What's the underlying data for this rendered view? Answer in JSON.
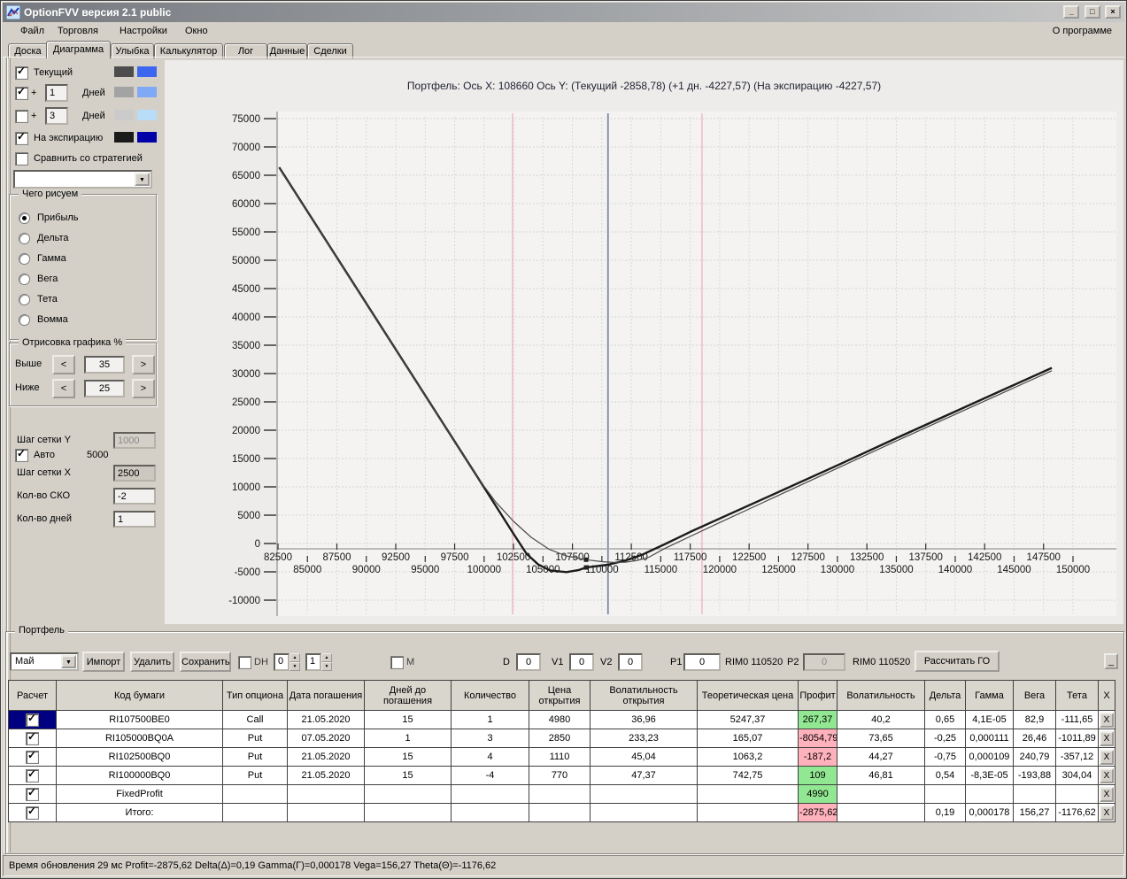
{
  "window": {
    "title": "OptionFVV версия 2.1 public",
    "controls": {
      "minimize": "_",
      "maximize": "□",
      "close": "×"
    }
  },
  "menu": {
    "items": [
      "Файл",
      "Торговля",
      "Настройки",
      "Окно"
    ],
    "right": "О программе"
  },
  "tabs": {
    "items": [
      "Доска",
      "Диаграмма",
      "Улыбка",
      "Калькулятор",
      "Лог",
      "Данные",
      "Сделки"
    ],
    "active": "Диаграмма"
  },
  "left_panel": {
    "legend_rows": [
      {
        "label": "Текущий",
        "checked": true,
        "colors": [
          "#4d4d4d",
          "#3c66f0"
        ]
      },
      {
        "prefix": "+",
        "value": "1",
        "label": "Дней",
        "checked": true,
        "colors": [
          "#a3a3a3",
          "#7fa8f5"
        ]
      },
      {
        "prefix": "+",
        "value": "3",
        "label": "Дней",
        "checked": false,
        "colors": [
          "#cbcbcb",
          "#b9dcf8"
        ]
      },
      {
        "label": "На экспирацию",
        "checked": true,
        "colors": [
          "#1a1a1a",
          "#0000a8"
        ]
      },
      {
        "label": "Сравнить со стратегией",
        "checked": false
      }
    ],
    "strategy_value": "",
    "draw_group": {
      "title": "Чего рисуем",
      "options": [
        "Прибыль",
        "Дельта",
        "Гамма",
        "Вега",
        "Тета",
        "Вомма"
      ],
      "selected": "Прибыль"
    },
    "render_group": {
      "title": "Отрисовка графика %",
      "dec": "<",
      "inc": ">",
      "rows": [
        {
          "label": "Выше",
          "value": "35"
        },
        {
          "label": "Ниже",
          "value": "25"
        }
      ]
    },
    "grid": {
      "y_label": "Шаг сетки Y",
      "y_value": "1000",
      "auto_label": "Авто",
      "auto_checked": true,
      "auto_value": "5000",
      "x_label": "Шаг сетки X",
      "x_value": "2500",
      "sko_label": "Кол-во СКО",
      "sko_value": "-2",
      "days_label": "Кол-во дней",
      "days_value": "1"
    }
  },
  "chart": {
    "title": "Портфель: Ось X: 108660 Ось Y:  (Текущий -2858,78)  (+1 дн. -4227,57)  (На экспирацию -4227,57)"
  },
  "chart_data": {
    "type": "line",
    "title": "Портфель: Ось X: 108660 Ось Y:  (Текущий -2858,78)  (+1 дн. -4227,57)  (На экспирацию -4227,57)",
    "x_range": [
      82500,
      151000
    ],
    "y_range": [
      -10000,
      75000
    ],
    "x_grid_step": 2500,
    "y_grid_step": 5000,
    "grid": true,
    "y_ticks": [
      75000,
      70000,
      65000,
      60000,
      55000,
      50000,
      45000,
      40000,
      35000,
      30000,
      25000,
      20000,
      15000,
      10000,
      5000,
      0,
      -5000,
      -10000
    ],
    "x_ticks_row1": [
      82500,
      87500,
      92500,
      97500,
      102500,
      107500,
      112500,
      117500,
      122500,
      127500,
      132500,
      137500,
      142500,
      147500
    ],
    "x_ticks_row2": [
      85000,
      90000,
      95000,
      100000,
      105000,
      110000,
      115000,
      120000,
      125000,
      130000,
      135000,
      140000,
      145000,
      150000
    ],
    "vlines": [
      {
        "x": 102420,
        "color": "#f2b6c0",
        "name": "sigma-lower"
      },
      {
        "x": 110520,
        "color": "#7d8aa0",
        "name": "current-price"
      },
      {
        "x": 118500,
        "color": "#f2b6c0",
        "name": "sigma-upper"
      }
    ],
    "series": [
      {
        "name": "На экспирацию / +1 дн.",
        "color": "#1b1b1b",
        "width": 2.4,
        "points": [
          [
            82600,
            66400
          ],
          [
            100000,
            9900
          ],
          [
            102500,
            1700
          ],
          [
            103600,
            -1800
          ],
          [
            104600,
            -3700
          ],
          [
            105600,
            -4750
          ],
          [
            107000,
            -5050
          ],
          [
            108000,
            -4700
          ],
          [
            108660,
            -4230
          ],
          [
            110500,
            -3750
          ],
          [
            112000,
            -3000
          ],
          [
            113500,
            -1900
          ],
          [
            115300,
            -150
          ],
          [
            117500,
            2050
          ],
          [
            120000,
            4400
          ],
          [
            125000,
            9100
          ],
          [
            130000,
            13800
          ],
          [
            135000,
            18600
          ],
          [
            140000,
            23300
          ],
          [
            145000,
            28000
          ],
          [
            148200,
            31000
          ]
        ]
      },
      {
        "name": "Текущий",
        "color": "#4a4a4a",
        "width": 1.2,
        "points": [
          [
            82600,
            66350
          ],
          [
            99500,
            11500
          ],
          [
            101000,
            7300
          ],
          [
            102500,
            3900
          ],
          [
            104000,
            1100
          ],
          [
            105500,
            -1000
          ],
          [
            107000,
            -2200
          ],
          [
            108660,
            -2860
          ],
          [
            110000,
            -3200
          ],
          [
            111000,
            -3350
          ],
          [
            112000,
            -3300
          ],
          [
            113000,
            -3000
          ],
          [
            114000,
            -2400
          ],
          [
            115300,
            -900
          ],
          [
            117500,
            1250
          ],
          [
            120000,
            3700
          ],
          [
            122500,
            6100
          ],
          [
            125000,
            8500
          ],
          [
            127500,
            10900
          ],
          [
            130000,
            13300
          ],
          [
            135000,
            18100
          ],
          [
            140000,
            22800
          ],
          [
            145000,
            27500
          ],
          [
            148200,
            30500
          ]
        ]
      }
    ],
    "markers": [
      {
        "x": 108660,
        "y": -2858.78,
        "series": "Текущий"
      },
      {
        "x": 108660,
        "y": -4227.57,
        "series": "На экспирацию / +1 дн."
      }
    ],
    "crosshair": {
      "x": 108660,
      "current": "-2858,78",
      "plus1day": "-4227,57",
      "expiration": "-4227,57"
    }
  },
  "portfolio": {
    "group_label": "Портфель",
    "toolbar": {
      "month_value": "Май",
      "import_label": "Импорт",
      "delete_label": "Удалить",
      "save_label": "Сохранить",
      "dh_label": "DH",
      "dh_checked": false,
      "spin1_value": "0",
      "spin2_value": "1",
      "m_label": "M",
      "m_checked": false,
      "d_label": "D",
      "d_value": "0",
      "v1_label": "V1",
      "v1_value": "0",
      "v2_label": "V2",
      "v2_value": "0",
      "p1_label": "P1",
      "p1_value": "0",
      "rim1_label": "RIM0 110520",
      "p2_label": "P2",
      "p2_value": "0",
      "rim2_label": "RIM0 110520",
      "calc_label": "Рассчитать ГО",
      "minimize_label": "_"
    },
    "table": {
      "headers": [
        "Расчет",
        "Код бумаги",
        "Тип опциона",
        "Дата погашения",
        "Дней до погашения",
        "Количество",
        "Цена открытия",
        "Волатильность открытия",
        "Теоретическая цена",
        "Профит",
        "Волатильность",
        "Дельта",
        "Гамма",
        "Вега",
        "Тета",
        "X"
      ],
      "x_button_label": "X",
      "profit_colors": {
        "green": "#92e892",
        "red": "#ffb2bc"
      },
      "rows": [
        {
          "checked": true,
          "selected": true,
          "profit_color": "green",
          "cells": [
            "RI107500BE0",
            "Call",
            "21.05.2020",
            "15",
            "1",
            "4980",
            "36,96",
            "5247,37",
            "267,37",
            "40,2",
            "0,65",
            "4,1E-05",
            "82,9",
            "-111,65"
          ]
        },
        {
          "checked": true,
          "selected": false,
          "profit_color": "red",
          "cells": [
            "RI105000BQ0A",
            "Put",
            "07.05.2020",
            "1",
            "3",
            "2850",
            "233,23",
            "165,07",
            "-8054,79",
            "73,65",
            "-0,25",
            "0,000111",
            "26,46",
            "-1011,89"
          ]
        },
        {
          "checked": true,
          "selected": false,
          "profit_color": "red",
          "cells": [
            "RI102500BQ0",
            "Put",
            "21.05.2020",
            "15",
            "4",
            "1110",
            "45,04",
            "1063,2",
            "-187,2",
            "44,27",
            "-0,75",
            "0,000109",
            "240,79",
            "-357,12"
          ]
        },
        {
          "checked": true,
          "selected": false,
          "profit_color": "green",
          "cells": [
            "RI100000BQ0",
            "Put",
            "21.05.2020",
            "15",
            "-4",
            "770",
            "47,37",
            "742,75",
            "109",
            "46,81",
            "0,54",
            "-8,3E-05",
            "-193,88",
            "304,04"
          ]
        },
        {
          "checked": true,
          "selected": false,
          "profit_color": "green",
          "cells": [
            "FixedProfit",
            "",
            "",
            "",
            "",
            "",
            "",
            "",
            "4990",
            "",
            "",
            "",
            "",
            ""
          ]
        },
        {
          "checked": true,
          "selected": false,
          "profit_color": "red",
          "cells": [
            "Итого:",
            "",
            "",
            "",
            "",
            "",
            "",
            "",
            "-2875,62",
            "",
            "0,19",
            "0,000178",
            "156,27",
            "-1176,62"
          ]
        }
      ]
    }
  },
  "status_bar": "Время обновления 29 мс  Profit=-2875,62 Delta(Δ)=0,19 Gamma(Γ)=0,000178 Vega=156,27 Theta(Θ)=-1176,62"
}
